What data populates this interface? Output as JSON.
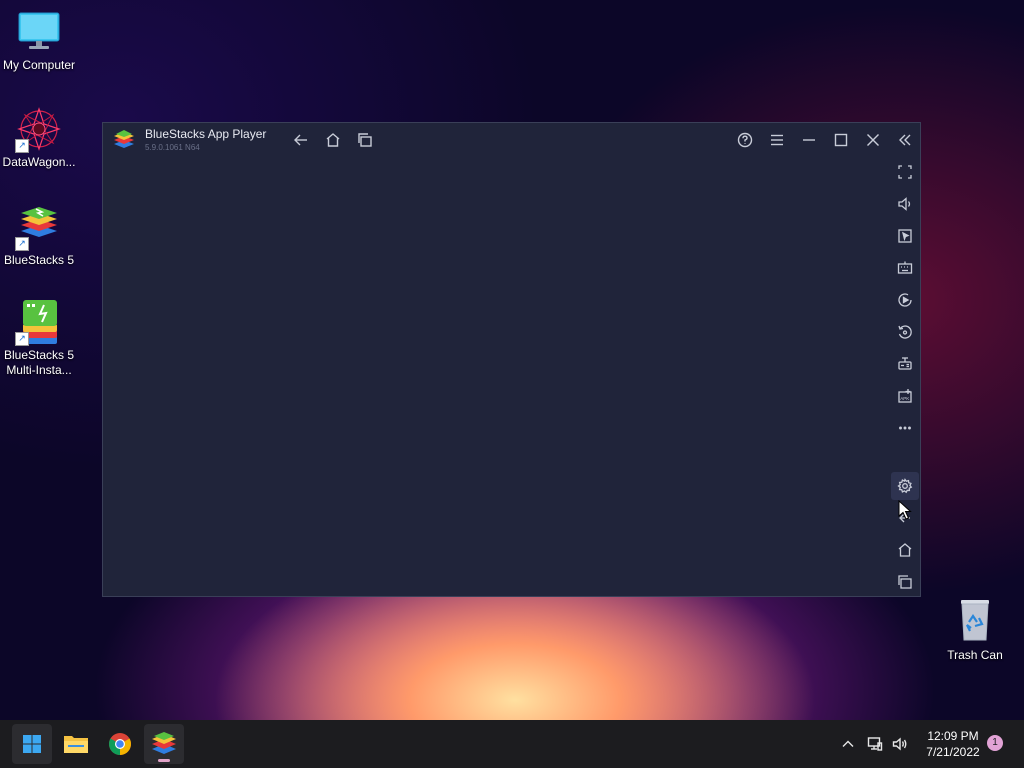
{
  "desktop": {
    "icons": [
      {
        "label": "My Computer",
        "icon": "monitor-icon"
      },
      {
        "label": "DataWagon...",
        "icon": "fractal-icon"
      },
      {
        "label": "BlueStacks 5",
        "icon": "bluestacks-icon"
      },
      {
        "label": "BlueStacks 5 Multi-Insta...",
        "icon": "bluestacks-multi-icon"
      }
    ],
    "trash": {
      "label": "Trash Can",
      "icon": "recycle-bin-icon"
    }
  },
  "window": {
    "title": "BlueStacks App Player",
    "version": "5.9.0.1061  N64",
    "titlebar_buttons": [
      "back-icon",
      "home-icon",
      "recent-apps-icon",
      "help-icon",
      "menu-icon",
      "minimize-icon",
      "maximize-icon",
      "close-icon",
      "collapse-sidebar-icon"
    ],
    "sidebar_buttons": [
      "fullscreen-icon",
      "volume-icon",
      "screen-record-icon",
      "keyboard-controls-icon",
      "macro-play-icon",
      "rotate-icon",
      "gamepad-icon",
      "install-apk-icon",
      "more-icon",
      "settings-icon",
      "back-icon",
      "home-icon",
      "recent-apps-icon"
    ]
  },
  "taskbar": {
    "apps": [
      "start-icon",
      "file-explorer-icon",
      "chrome-icon",
      "bluestacks-icon"
    ],
    "clock": {
      "time": "12:09 PM",
      "date": "7/21/2022"
    },
    "notification_count": "1"
  },
  "colors": {
    "window_bg": "#20243a",
    "taskbar_bg": "#1c1c1f",
    "accent": "#e2a3d6"
  }
}
